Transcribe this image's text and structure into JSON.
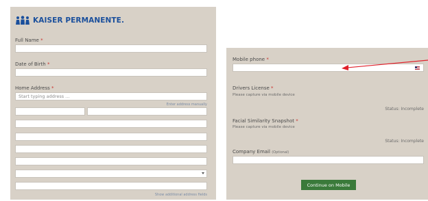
{
  "brand": {
    "name": "KAISER PERMANENTE."
  },
  "left_form": {
    "full_name_label": "Full Name",
    "dob_label": "Date of Birth",
    "home_address_label": "Home Address",
    "address_placeholder": "Start typing address ...",
    "enter_manually_link": "Enter address manually",
    "show_more_link": "Show additional address fields",
    "required_mark": "*"
  },
  "right_form": {
    "mobile_label": "Mobile phone",
    "drivers_label": "Drivers License",
    "drivers_hint": "Please capture via mobile device",
    "drivers_status": "Status: Incomplete",
    "facial_label": "Facial Similarity Snapshot",
    "facial_hint": "Please capture via mobile device",
    "facial_status": "Status: Incomplete",
    "company_email_label": "Company Email",
    "company_email_optional": "(Optional)",
    "continue_button": "Continue on Mobile",
    "required_mark": "*"
  },
  "colors": {
    "panel": "#d8d1c7",
    "brand": "#1a4f9c",
    "button": "#3a7a3a",
    "required": "#c9302c",
    "arrow": "#e0202a"
  },
  "icons": {
    "logo": "kaiser-figures-icon",
    "flag": "us-flag-icon",
    "select": "chevron-down-icon"
  }
}
